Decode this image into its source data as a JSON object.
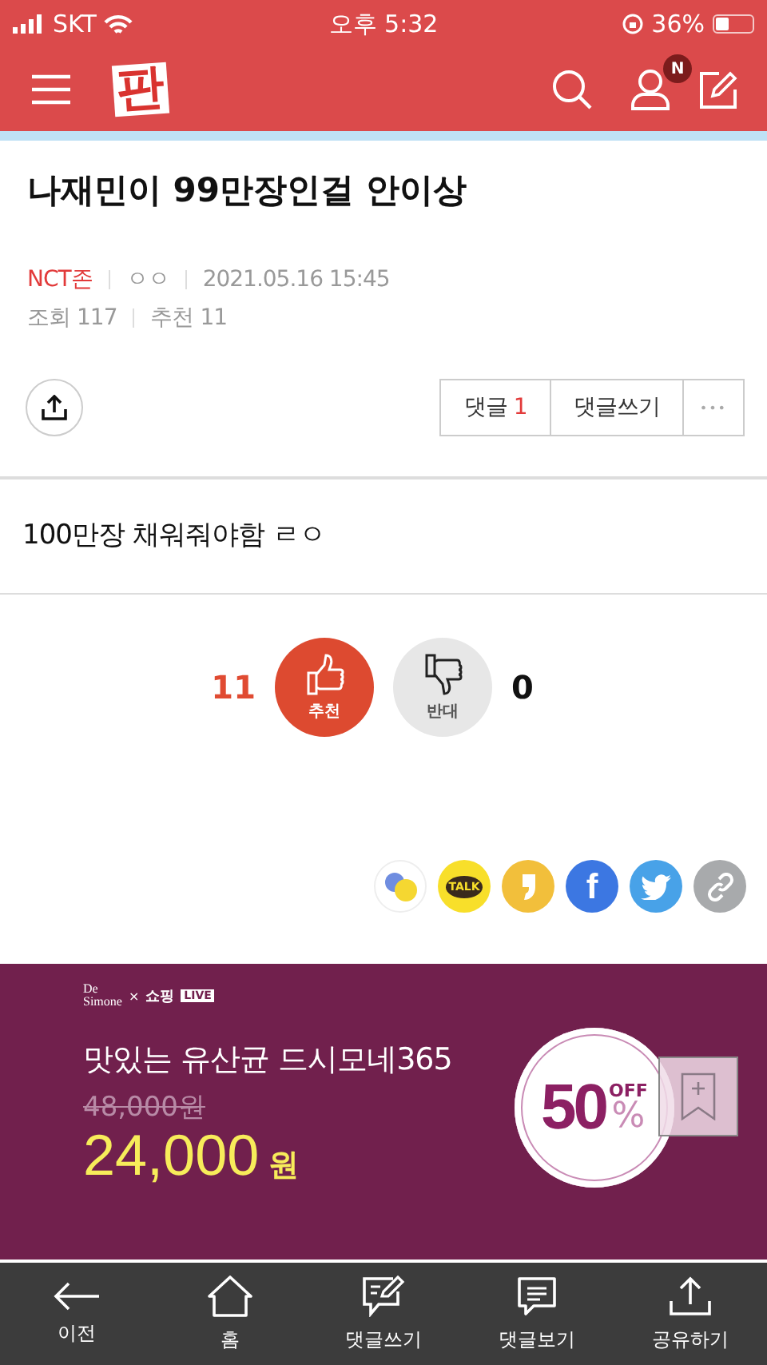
{
  "status_bar": {
    "carrier": "SKT",
    "time": "오후 5:32",
    "battery": "36%"
  },
  "header": {
    "logo": "판",
    "badge": "N"
  },
  "post": {
    "title": "나재민이 99만장인걸 안이상",
    "category": "NCT존",
    "author": "ㅇㅇ",
    "date": "2021.05.16 15:45",
    "views_label": "조회",
    "views": "117",
    "recommend_label": "추천",
    "recommend": "11",
    "comment_tab": {
      "label": "댓글",
      "count": "1"
    },
    "write_comment": "댓글쓰기",
    "more": "•••",
    "body": "100만장 채워줘야함 ㄹㅇ"
  },
  "votes": [
    {
      "kind": "up",
      "count": "11",
      "label": "추천"
    },
    {
      "kind": "down",
      "count": "0",
      "label": "반대"
    }
  ],
  "share_buttons": [
    {
      "kind": "band"
    },
    {
      "kind": "kakao",
      "label": "TALK"
    },
    {
      "kind": "story"
    },
    {
      "kind": "facebook",
      "label": "f"
    },
    {
      "kind": "twitter"
    },
    {
      "kind": "link"
    }
  ],
  "ad": {
    "brand_top": "De",
    "brand_bottom": "Simone",
    "cross": "×",
    "partner": "쇼핑",
    "partner_tag": "LIVE",
    "headline": "맛있는 유산균 드시모네365",
    "old_price": "48,000원",
    "price": "24,000",
    "currency": "원",
    "discount": "50",
    "off": "OFF",
    "percent": "%"
  },
  "bottom_nav": [
    {
      "kind": "back",
      "label": "이전"
    },
    {
      "kind": "home",
      "label": "홈"
    },
    {
      "kind": "write",
      "label": "댓글쓰기"
    },
    {
      "kind": "comments",
      "label": "댓글보기"
    },
    {
      "kind": "share",
      "label": "공유하기"
    }
  ]
}
